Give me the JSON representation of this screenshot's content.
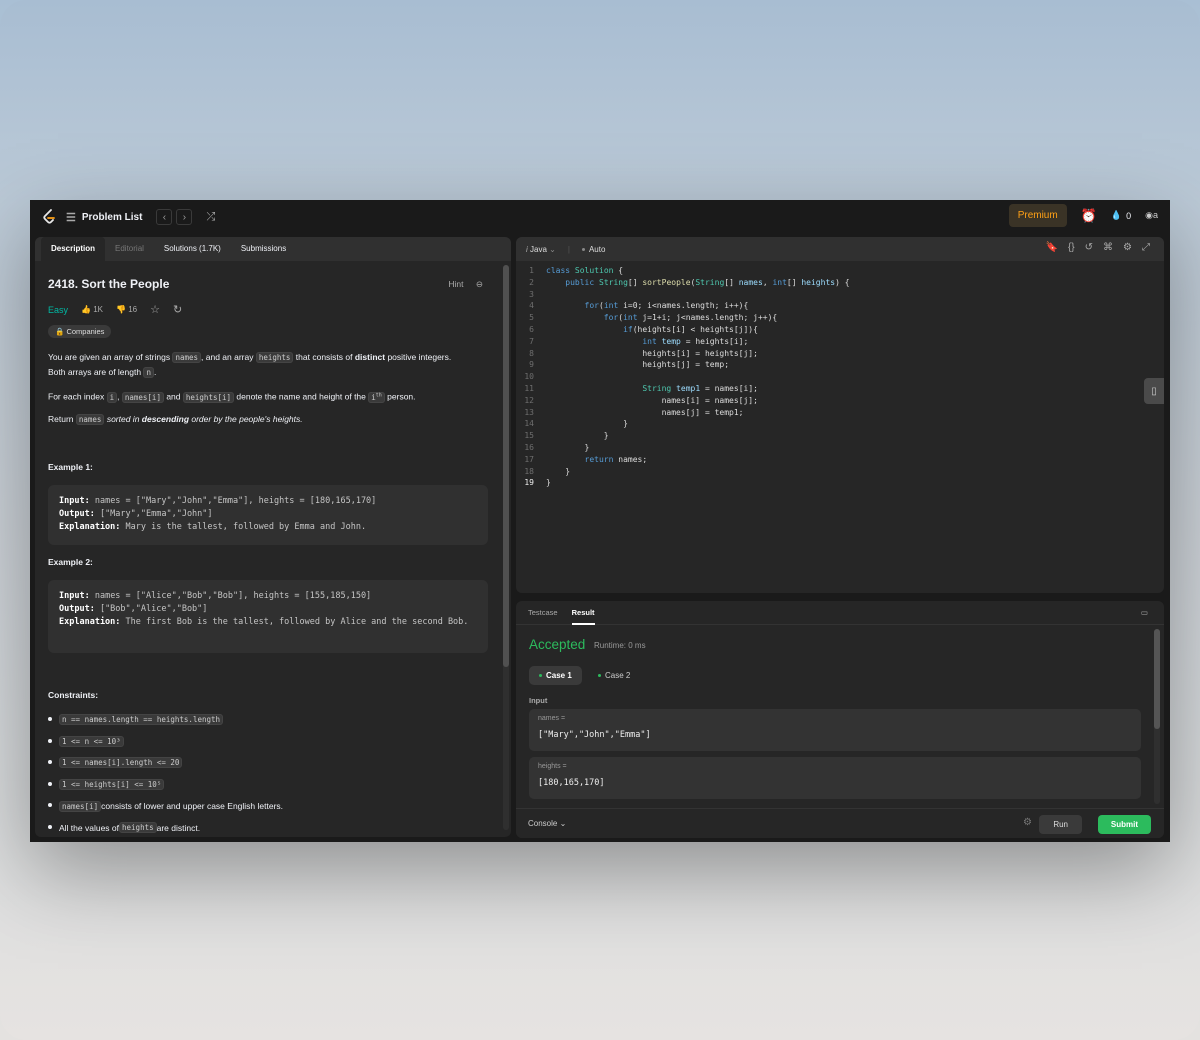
{
  "topbar": {
    "problem_list": "Problem List",
    "premium": "Premium",
    "streak": "0",
    "avatar_alt": "a"
  },
  "left_tabs": [
    "Description",
    "Editorial",
    "Solutions (1.7K)",
    "Submissions"
  ],
  "problem": {
    "title": "2418. Sort the People",
    "hint": "Hint",
    "difficulty": "Easy",
    "likes": "1K",
    "dislikes": "16",
    "companies": "Companies",
    "p1a": "You are given an array of strings ",
    "p1b": "names",
    "p1c": ", and an array ",
    "p1d": "heights",
    "p1e": " that consists of ",
    "p1f": "distinct",
    "p1g": " positive integers.",
    "p1h": "Both arrays are of length ",
    "p1i": "n",
    "p1j": ".",
    "p2a": "For each index ",
    "p2b": "i",
    "p2c": ", ",
    "p2d": "names[i]",
    "p2e": " and ",
    "p2f": "heights[i]",
    "p2g": " denote the name and height of the ",
    "p2h": "i",
    "p2i": "th",
    "p2j": " person.",
    "p3a": "Return ",
    "p3b": "names",
    "p3c": " sorted in ",
    "p3d": "descending",
    "p3e": " order by the people's heights.",
    "ex1_title": "Example 1:",
    "ex1": {
      "in_k": "Input:",
      "in_v": " names = [\"Mary\",\"John\",\"Emma\"], heights = [180,165,170]",
      "out_k": "Output:",
      "out_v": " [\"Mary\",\"Emma\",\"John\"]",
      "exp_k": "Explanation:",
      "exp_v": " Mary is the tallest, followed by Emma and John."
    },
    "ex2_title": "Example 2:",
    "ex2": {
      "in_k": "Input:",
      "in_v": " names = [\"Alice\",\"Bob\",\"Bob\"], heights = [155,185,150]",
      "out_k": "Output:",
      "out_v": " [\"Bob\",\"Alice\",\"Bob\"]",
      "exp_k": "Explanation:",
      "exp_v": " The first Bob is the tallest, followed by Alice and the second Bob."
    },
    "constraints_title": "Constraints:",
    "c1": "n == names.length == heights.length",
    "c2": "1 <= n <= 10³",
    "c3": "1 <= names[i].length <= 20",
    "c4": "1 <= heights[i] <= 10⁵",
    "c5a": "names[i]",
    "c5b": " consists of lower and upper case English letters.",
    "c6a": "All the values of ",
    "c6b": "heights",
    "c6c": " are distinct."
  },
  "editor": {
    "language": "Java",
    "mode": "Auto"
  },
  "bottom": {
    "tab_testcase": "Testcase",
    "tab_result": "Result",
    "status": "Accepted",
    "runtime": "Runtime: 0 ms",
    "case1": "Case 1",
    "case2": "Case 2",
    "input_label": "Input",
    "names_key": "names =",
    "names_val": "[\"Mary\",\"John\",\"Emma\"]",
    "heights_key": "heights =",
    "heights_val": "[180,165,170]",
    "console": "Console",
    "run": "Run",
    "submit": "Submit"
  },
  "colors": {
    "accent": "#ffa116",
    "accepted": "#2cbb5d",
    "easy": "#00b8a3"
  }
}
